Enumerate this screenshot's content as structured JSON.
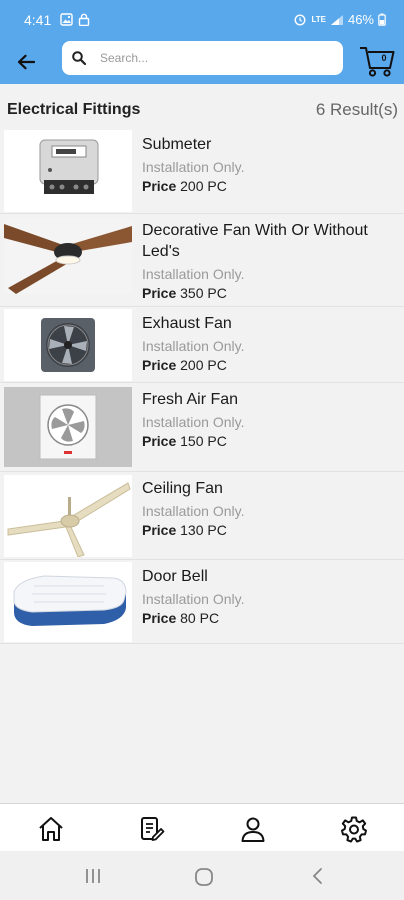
{
  "status": {
    "time": "4:41",
    "battery": "46%",
    "network_label": "LTE",
    "left_icons": [
      "image-icon",
      "lock-icon"
    ],
    "right_icons": [
      "alarm-icon",
      "lte-icon",
      "signal-icon",
      "battery-icon"
    ]
  },
  "appbar": {
    "search_placeholder": "Search...",
    "search_value": "",
    "cart_count": "0"
  },
  "section": {
    "title": "Electrical Fittings",
    "count": "6 Result(s)"
  },
  "price_label": "Price",
  "products": [
    {
      "name": "Submeter",
      "subtitle": "Installation Only.",
      "price": "200 PC",
      "image": "submeter"
    },
    {
      "name": "Decorative Fan With Or Without Led's",
      "subtitle": "Installation Only.",
      "price": "350 PC",
      "image": "decorative-fan"
    },
    {
      "name": "Exhaust Fan",
      "subtitle": "Installation Only.",
      "price": "200 PC",
      "image": "exhaust-fan"
    },
    {
      "name": "Fresh Air Fan",
      "subtitle": "Installation Only.",
      "price": "150 PC",
      "image": "fresh-air-fan"
    },
    {
      "name": "Ceiling Fan",
      "subtitle": "Installation Only.",
      "price": "130 PC",
      "image": "ceiling-fan"
    },
    {
      "name": "Door Bell",
      "subtitle": "Installation Only.",
      "price": "80 PC",
      "image": "door-bell"
    }
  ],
  "bottom_nav": [
    "home-icon",
    "orders-icon",
    "profile-icon",
    "settings-icon"
  ],
  "colors": {
    "accent": "#5aa8ec",
    "background": "#f2f2f2"
  }
}
